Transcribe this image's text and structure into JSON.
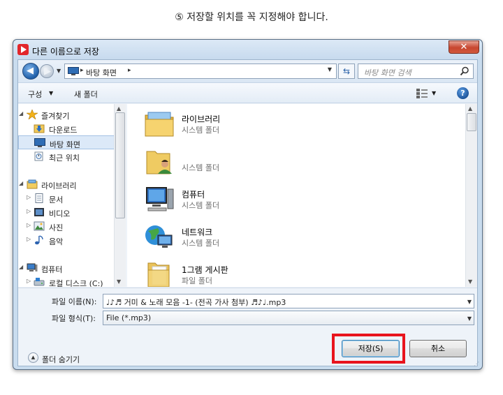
{
  "caption": "⑤ 저장할 위치를 꼭 지정해야 합니다.",
  "window": {
    "title": "다른 이름으로 저장",
    "close_glyph": "✕"
  },
  "navbar": {
    "address": "바탕 화면",
    "search_placeholder": "바탕 화면 검색"
  },
  "toolbar": {
    "organize": "구성",
    "new_folder": "새 폴더",
    "help": "?"
  },
  "nav_tree": [
    {
      "label": "즐겨찾기",
      "icon": "star-icon",
      "level": 0,
      "expander": "◢"
    },
    {
      "label": "다운로드",
      "icon": "download-folder-icon",
      "level": 1
    },
    {
      "label": "바탕 화면",
      "icon": "desktop-icon",
      "level": 1,
      "selected": true
    },
    {
      "label": "최근 위치",
      "icon": "recent-places-icon",
      "level": 1
    },
    {
      "label": "라이브러리",
      "icon": "library-icon",
      "level": 0,
      "expander": "◢"
    },
    {
      "label": "문서",
      "icon": "documents-icon",
      "level": 1,
      "expander": "▷"
    },
    {
      "label": "비디오",
      "icon": "video-icon",
      "level": 1,
      "expander": "▷"
    },
    {
      "label": "사진",
      "icon": "pictures-icon",
      "level": 1,
      "expander": "▷"
    },
    {
      "label": "음악",
      "icon": "music-icon",
      "level": 1,
      "expander": "▷"
    },
    {
      "label": "컴퓨터",
      "icon": "computer-icon",
      "level": 0,
      "expander": "◢"
    },
    {
      "label": "로컬 디스크 (C:)",
      "icon": "disk-icon",
      "level": 1,
      "expander": "▷"
    }
  ],
  "files": [
    {
      "name": "라이브러리",
      "type": "시스템 폴더",
      "icon": "library-folder-icon"
    },
    {
      "name": "",
      "type": "시스템 폴더",
      "icon": "user-folder-icon"
    },
    {
      "name": "컴퓨터",
      "type": "시스템 폴더",
      "icon": "computer-icon"
    },
    {
      "name": "네트워크",
      "type": "시스템 폴더",
      "icon": "network-icon"
    },
    {
      "name": "1그램 게시판",
      "type": "파일 폴더",
      "icon": "folder-icon"
    }
  ],
  "form": {
    "filename_label": "파일 이름(N):",
    "filename_value": "♩♪♬ 거미 & 노래 모음 -1- (전곡 가사 첨부) ♬♪♩.mp3",
    "filetype_label": "파일 형식(T):",
    "filetype_value": "File (*.mp3)",
    "hide_folders": "폴더 숨기기",
    "save": "저장(S)",
    "cancel": "취소"
  },
  "colors": {
    "highlight": "#e8141d",
    "window_frame": "#c9dcee",
    "selection": "#dce9f8"
  }
}
